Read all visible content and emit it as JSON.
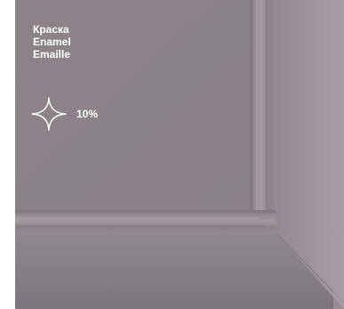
{
  "finish": {
    "names": [
      "Краска",
      "Enamel",
      "Emaille"
    ],
    "color_hex": "#8b8389"
  },
  "gloss": {
    "icon": "sparkle-icon",
    "value": "10%"
  }
}
